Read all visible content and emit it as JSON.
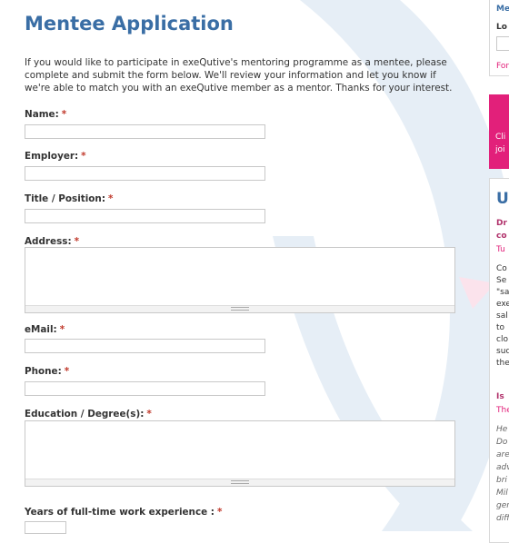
{
  "page": {
    "title": "Mentee Application",
    "intro": "If you would like to participate in exeQutive's mentoring programme as a mentee, please complete and submit the form below.  We'll review your information and let you know if we're able to match you with an exeQutive member as a mentor.  Thanks for your interest."
  },
  "form": {
    "required_mark": "*",
    "fields": {
      "name": "Name:",
      "employer": "Employer:",
      "title": "Title / Position:",
      "address": "Address:",
      "email": "eMail:",
      "phone": "Phone:",
      "education": "Education / Degree(s):",
      "experience": "Years of full-time work experience :"
    }
  },
  "sidebar": {
    "login_title": "Me",
    "login_label": "Lo",
    "forgot": "For",
    "pink_line1": "Cli",
    "pink_line2": "joi",
    "updates_heading": "U",
    "post1_title_1": "Dr",
    "post1_title_2": "co",
    "post1_date": "Tu",
    "post1_body": [
      "Co",
      "Se",
      "\"sa",
      "exe",
      "sal",
      "to",
      "clo",
      "suc",
      "the"
    ],
    "post2_title": "Is",
    "post2_meta": "The",
    "post2_body": [
      "He",
      " Do",
      "are",
      "adv",
      "bri",
      "Mil",
      "gen",
      "diff"
    ]
  },
  "colors": {
    "title": "#3a6ea5",
    "required": "#c0392b",
    "accent_pink": "#e2207a",
    "watermark": "#dfe9f3"
  }
}
